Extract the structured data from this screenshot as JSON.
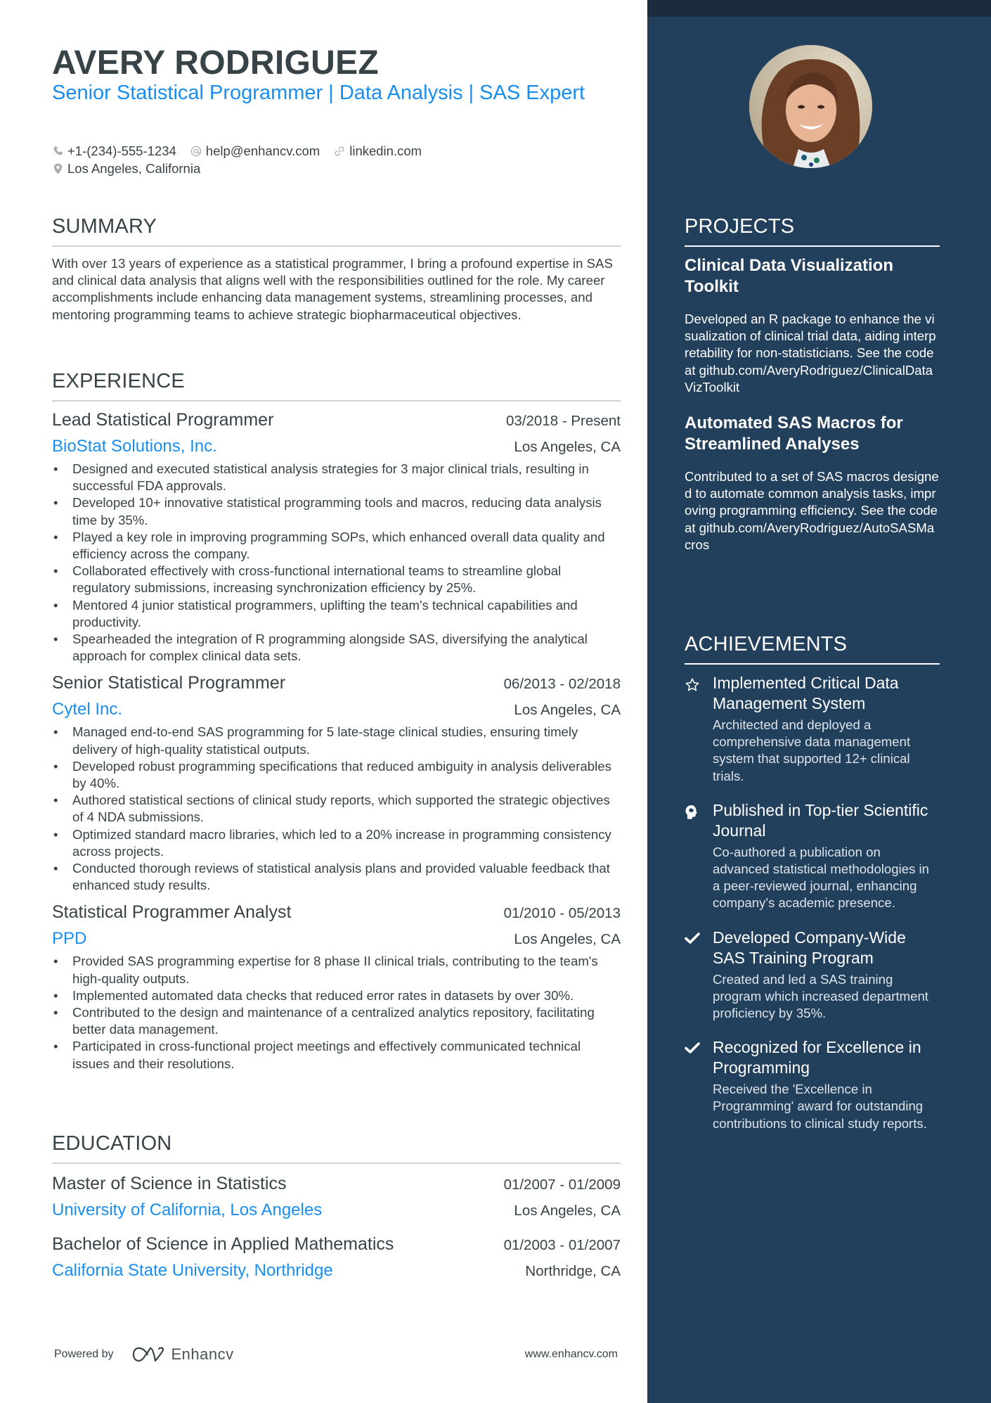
{
  "header": {
    "name": "AVERY RODRIGUEZ",
    "headline": "Senior Statistical Programmer | Data Analysis | SAS Expert",
    "contacts": [
      {
        "icon": "phone-icon",
        "value": "+1-(234)-555-1234"
      },
      {
        "icon": "at-icon",
        "value": "help@enhancv.com"
      },
      {
        "icon": "link-icon",
        "value": "linkedin.com"
      },
      {
        "icon": "location-pin-icon",
        "value": "Los Angeles, California"
      }
    ]
  },
  "summary": {
    "title": "SUMMARY",
    "text": "With over 13 years of experience as a statistical programmer, I bring a profound expertise in SAS and clinical data analysis that aligns well with the responsibilities outlined for the role. My career accomplishments include enhancing data management systems, streamlining processes, and mentoring programming teams to achieve strategic biopharmaceutical objectives."
  },
  "experience": {
    "title": "EXPERIENCE",
    "jobs": [
      {
        "title": "Lead Statistical Programmer",
        "dates": "03/2018 - Present",
        "company": "BioStat Solutions, Inc.",
        "location": "Los Angeles, CA",
        "bullets": [
          "Designed and executed statistical analysis strategies for 3 major clinical trials, resulting in successful FDA approvals.",
          "Developed 10+ innovative statistical programming tools and macros, reducing data analysis time by 35%.",
          "Played a key role in improving programming SOPs, which enhanced overall data quality and efficiency across the company.",
          "Collaborated effectively with cross-functional international teams to streamline global regulatory submissions, increasing synchronization efficiency by 25%.",
          "Mentored 4 junior statistical programmers, uplifting the team's technical capabilities and productivity.",
          "Spearheaded the integration of R programming alongside SAS, diversifying the analytical approach for complex clinical data sets."
        ]
      },
      {
        "title": "Senior Statistical Programmer",
        "dates": "06/2013 - 02/2018",
        "company": "Cytel Inc.",
        "location": "Los Angeles, CA",
        "bullets": [
          "Managed end-to-end SAS programming for 5 late-stage clinical studies, ensuring timely delivery of high-quality statistical outputs.",
          "Developed robust programming specifications that reduced ambiguity in analysis deliverables by 40%.",
          "Authored statistical sections of clinical study reports, which supported the strategic objectives of 4 NDA submissions.",
          "Optimized standard macro libraries, which led to a 20% increase in programming consistency across projects.",
          "Conducted thorough reviews of statistical analysis plans and provided valuable feedback that enhanced study results."
        ]
      },
      {
        "title": "Statistical Programmer Analyst",
        "dates": "01/2010 - 05/2013",
        "company": "PPD",
        "location": "Los Angeles, CA",
        "bullets": [
          "Provided SAS programming expertise for 8 phase II clinical trials, contributing to the team's high-quality outputs.",
          "Implemented automated data checks that reduced error rates in datasets by over 30%.",
          "Contributed to the design and maintenance of a centralized analytics repository, facilitating better data management.",
          "Participated in cross-functional project meetings and effectively communicated technical issues and their resolutions."
        ]
      }
    ]
  },
  "education": {
    "title": "EDUCATION",
    "items": [
      {
        "degree": "Master of Science in Statistics",
        "dates": "01/2007 - 01/2009",
        "school": "University of California, Los Angeles",
        "location": "Los Angeles, CA"
      },
      {
        "degree": "Bachelor of Science in Applied Mathematics",
        "dates": "01/2003 - 01/2007",
        "school": "California State University, Northridge",
        "location": "Northridge, CA"
      }
    ]
  },
  "footer": {
    "powered_by": "Powered by",
    "brand": "Enhancv",
    "website": "www.enhancv.com"
  },
  "projects": {
    "title": "PROJECTS",
    "items": [
      {
        "title": "Clinical Data Visualization Toolkit",
        "description": "Developed an R package to enhance the visualization of clinical trial data, aiding interpretability for non-statisticians. See the code at github.com/AveryRodriguez/ClinicalDataVizToolkit"
      },
      {
        "title": "Automated SAS Macros for Streamlined Analyses",
        "description": "Contributed to a set of SAS macros designed to automate common analysis tasks, improving programming efficiency. See the code at github.com/AveryRodriguez/AutoSASMacros"
      }
    ]
  },
  "achievements": {
    "title": "ACHIEVEMENTS",
    "items": [
      {
        "icon": "star-icon",
        "title": "Implemented Critical Data Management System",
        "description": "Architected and deployed a comprehensive data management system that supported 12+ clinical trials."
      },
      {
        "icon": "brain-head-icon",
        "title": "Published in Top-tier Scientific Journal",
        "description": "Co-authored a publication on advanced statistical methodologies in a peer-reviewed journal, enhancing company's academic presence."
      },
      {
        "icon": "checkmark-icon",
        "title": "Developed Company-Wide SAS Training Program",
        "description": "Created and led a SAS training program which increased department proficiency by 35%."
      },
      {
        "icon": "checkmark-icon",
        "title": "Recognized for Excellence in Programming",
        "description": "Received the 'Excellence in Programming' award for outstanding contributions to clinical study reports."
      }
    ]
  },
  "colors": {
    "accent": "#1a8ef0",
    "text": "#384347",
    "sidebar_bg": "#22405c",
    "sidebar_strip": "#1b2b40"
  }
}
